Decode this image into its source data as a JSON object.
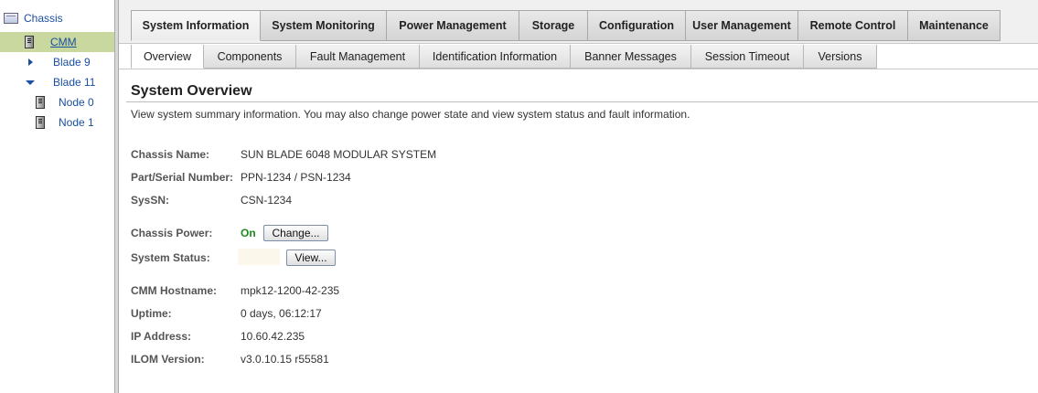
{
  "tree": {
    "chassis": "Chassis",
    "cmm": "CMM",
    "blade9": "Blade 9",
    "blade11": "Blade 11",
    "node0": "Node 0",
    "node1": "Node 1"
  },
  "tabs": [
    "System Information",
    "System Monitoring",
    "Power Management",
    "Storage",
    "Configuration",
    "User Management",
    "Remote Control",
    "Maintenance"
  ],
  "subtabs": [
    "Overview",
    "Components",
    "Fault Management",
    "Identification Information",
    "Banner Messages",
    "Session Timeout",
    "Versions"
  ],
  "page": {
    "title": "System Overview",
    "description": "View system summary information. You may also change power state and view system status and fault information."
  },
  "fields": {
    "chassis_name_label": "Chassis Name:",
    "chassis_name_value": "SUN BLADE 6048 MODULAR SYSTEM",
    "part_serial_label": "Part/Serial Number:",
    "part_serial_value": "PPN-1234 / PSN-1234",
    "syssn_label": "SysSN:",
    "syssn_value": "CSN-1234",
    "chassis_power_label": "Chassis Power:",
    "chassis_power_value": "On",
    "change_button": "Change...",
    "system_status_label": "System Status:",
    "view_button": "View...",
    "cmm_hostname_label": "CMM Hostname:",
    "cmm_hostname_value": "mpk12-1200-42-235",
    "uptime_label": "Uptime:",
    "uptime_value": "0 days, 06:12:17",
    "ip_address_label": "IP Address:",
    "ip_address_value": "10.60.42.235",
    "ilom_version_label": "ILOM Version:",
    "ilom_version_value": "v3.0.10.15 r55581"
  },
  "colors": {
    "selected_tree_row": "#c9d89e",
    "power_on": "#1d8a1d",
    "link": "#1a4fa0"
  }
}
